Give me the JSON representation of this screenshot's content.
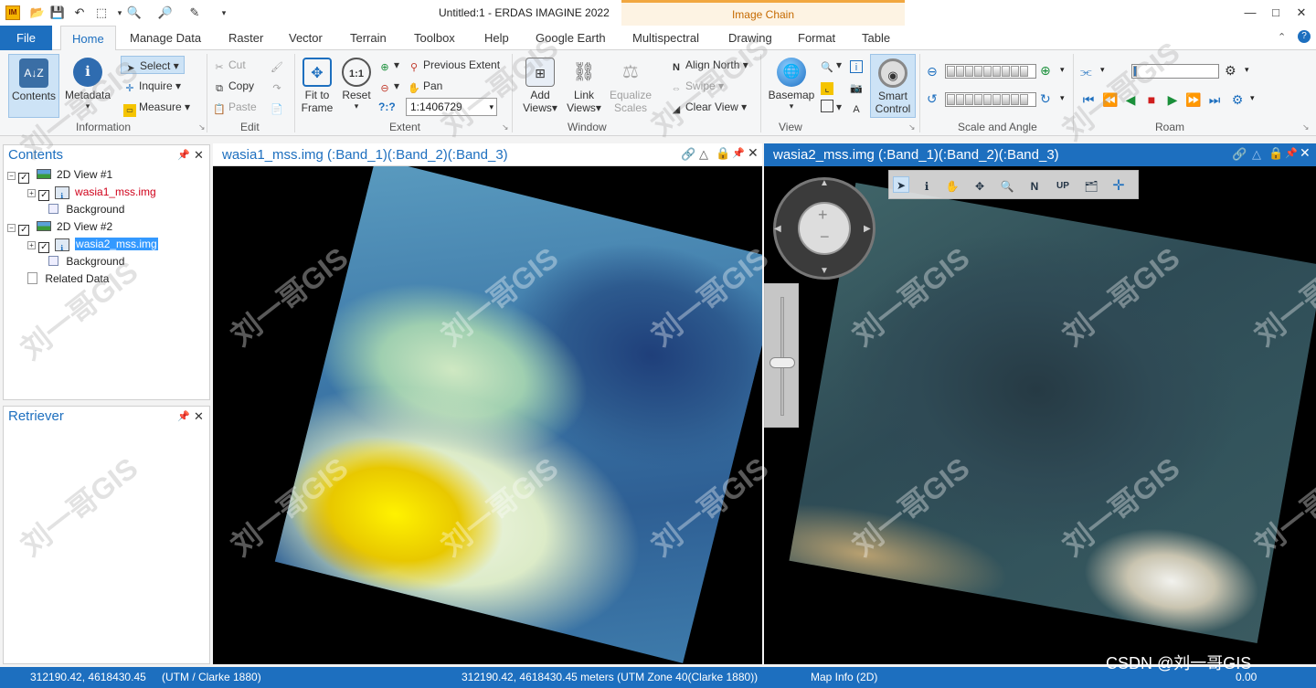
{
  "title_bar": {
    "app_icon": "IM",
    "title": "Untitled:1 - ERDAS IMAGINE 2022",
    "contextual_tab": "Image Chain",
    "window_controls": [
      "—",
      "□",
      "✕"
    ]
  },
  "tabs": {
    "file": "File",
    "items": [
      "Home",
      "Manage Data",
      "Raster",
      "Vector",
      "Terrain",
      "Toolbox",
      "Help",
      "Google Earth",
      "Multispectral",
      "Drawing",
      "Format",
      "Table"
    ]
  },
  "ribbon": {
    "information": {
      "label": "Information",
      "contents": "Contents",
      "metadata": "Metadata",
      "select": "Select",
      "inquire": "Inquire",
      "measure": "Measure"
    },
    "edit": {
      "label": "Edit",
      "cut": "Cut",
      "copy": "Copy",
      "paste": "Paste"
    },
    "extent": {
      "label": "Extent",
      "fit_to": "Fit to",
      "frame": "Frame",
      "reset": "Reset",
      "previous_extent": "Previous Extent",
      "pan": "Pan",
      "scale_value": "1:1406729",
      "unknown_glyph": "?:?"
    },
    "window": {
      "label": "Window",
      "add": "Add",
      "views": "Views",
      "link": "Link",
      "link_views": "Views",
      "equalize": "Equalize",
      "scales": "Scales",
      "align_north": "Align North",
      "swipe": "Swipe",
      "clear_view": "Clear View"
    },
    "view": {
      "label": "View",
      "basemap": "Basemap",
      "smart": "Smart",
      "control": "Control"
    },
    "scale_angle": {
      "label": "Scale and Angle"
    },
    "roam": {
      "label": "Roam"
    }
  },
  "contents_panel": {
    "title": "Contents",
    "items": [
      {
        "label": "2D View #1"
      },
      {
        "label": "wasia1_mss.img"
      },
      {
        "label": "Background"
      },
      {
        "label": "2D View #2"
      },
      {
        "label": "wasia2_mss.img"
      },
      {
        "label": "Background"
      },
      {
        "label": "Related Data"
      }
    ]
  },
  "retriever_panel": {
    "title": "Retriever"
  },
  "viewers": {
    "view1": {
      "title": "wasia1_mss.img (:Band_1)(:Band_2)(:Band_3)"
    },
    "view2": {
      "title": "wasia2_mss.img (:Band_1)(:Band_2)(:Band_3)",
      "toolbar_n": "N",
      "toolbar_up": "UP"
    }
  },
  "status_bar": {
    "coords": "312190.42, 4618430.45",
    "projection": "(UTM / Clarke 1880)",
    "coords_long": "312190.42, 4618430.45 meters (UTM Zone 40(Clarke 1880))",
    "map_info": "Map Info (2D)",
    "value": "0.00"
  },
  "watermark": {
    "text": "刘一哥GIS",
    "csdn": "CSDN @刘一哥GIS"
  },
  "colors": {
    "accent": "#1d6fbf",
    "layer_red": "#d0021b",
    "contextual": "#c56a00"
  }
}
